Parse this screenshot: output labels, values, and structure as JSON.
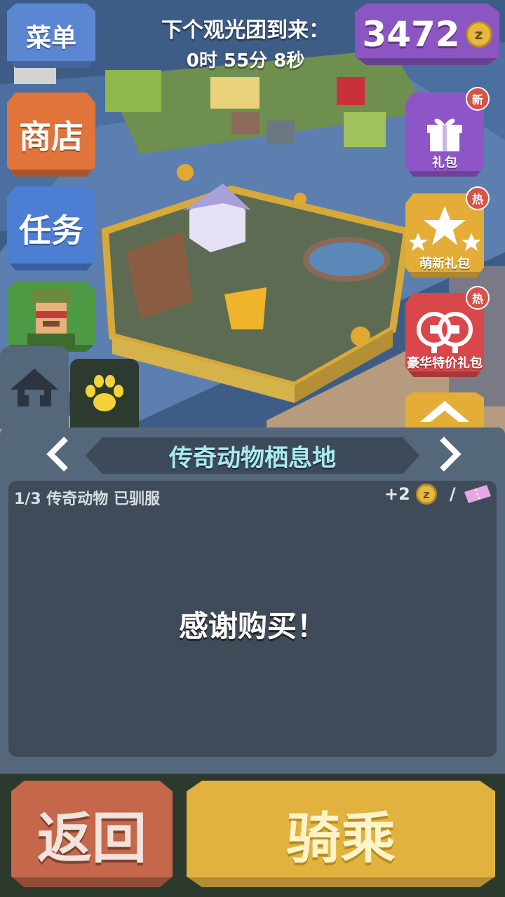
{
  "hud": {
    "menu_label": "菜单",
    "tour_label": "下个观光团到来：",
    "tour_timer": "0时 55分 8秒",
    "coins": "3472",
    "coin_symbol": "z"
  },
  "left_menu": {
    "shop_label": "商店",
    "quest_label": "任务",
    "ranger_icon": "ranger-portrait-icon"
  },
  "right_menu": {
    "gift": {
      "label": "礼包",
      "badge": "新",
      "icon": "gift-box-icon"
    },
    "starter_pack": {
      "label": "萌新礼包",
      "badge": "热",
      "icon": "stars-icon"
    },
    "deluxe_pack": {
      "label": "豪华特价礼包",
      "badge": "热",
      "icon": "coins-icon"
    },
    "extra_icon": "ribbon-icon"
  },
  "tabs": {
    "home_icon": "home-icon",
    "animals_icon": "paw-icon"
  },
  "panel": {
    "title": "传奇动物栖息地",
    "progress": "1/3 传奇动物 已驯服",
    "reward": "+2",
    "reward_separator": "/",
    "message": "感谢购买！"
  },
  "actions": {
    "back_label": "返回",
    "ride_label": "骑乘"
  },
  "colors": {
    "panel": "#55677a",
    "content": "#3f4b59",
    "title_text": "#a8ecec",
    "back_button": "#c4674a",
    "ride_button": "#e1b23d",
    "coins_pill": "#8b56c2",
    "menu_button": "#5b87d2"
  }
}
